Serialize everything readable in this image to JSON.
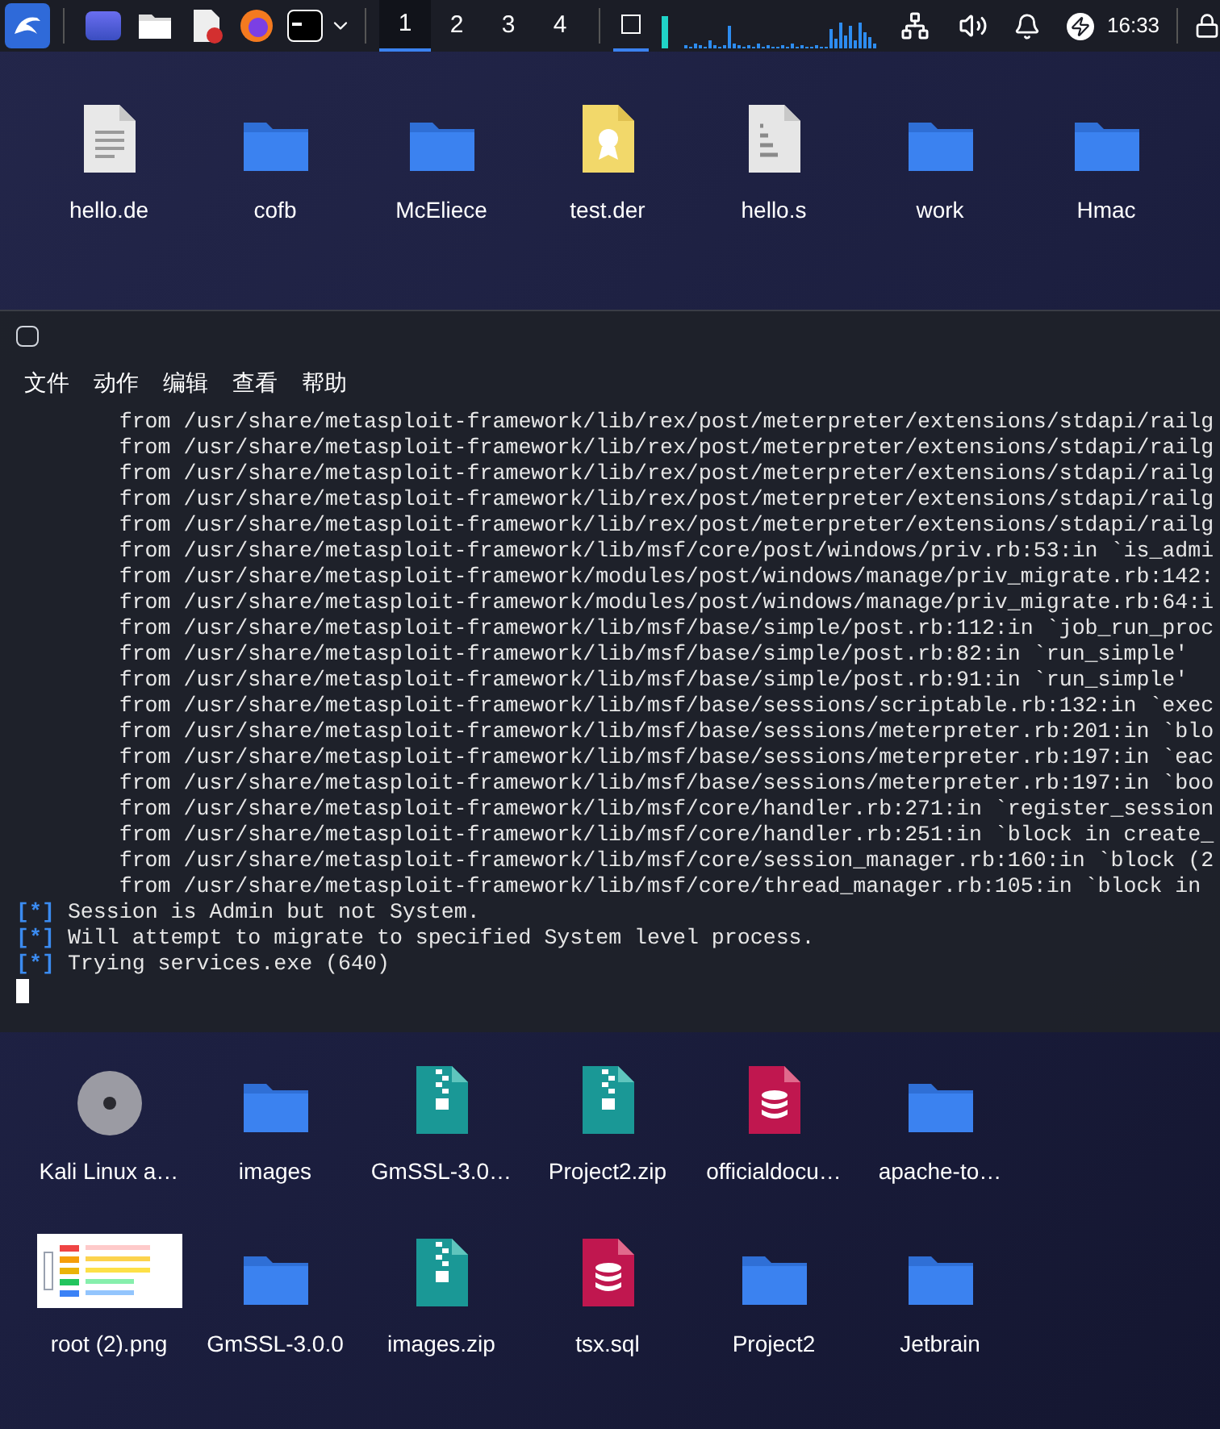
{
  "taskbar": {
    "workspaces": [
      {
        "label": "1",
        "selected": true
      },
      {
        "label": "2",
        "selected": false
      },
      {
        "label": "3",
        "selected": false
      },
      {
        "label": "4",
        "selected": false
      }
    ],
    "clock": "16:33"
  },
  "desktop_top": [
    {
      "label": "hello.de",
      "kind": "document"
    },
    {
      "label": "cofb",
      "kind": "folder"
    },
    {
      "label": "McEliece",
      "kind": "folder"
    },
    {
      "label": "test.der",
      "kind": "certificate"
    },
    {
      "label": "hello.s",
      "kind": "binary"
    },
    {
      "label": "work",
      "kind": "folder"
    },
    {
      "label": "Hmac",
      "kind": "folder"
    }
  ],
  "terminal": {
    "menu": [
      "文件",
      "动作",
      "编辑",
      "查看",
      "帮助"
    ],
    "lines": [
      {
        "kind": "trace",
        "text": "        from /usr/share/metasploit-framework/lib/rex/post/meterpreter/extensions/stdapi/railg"
      },
      {
        "kind": "trace",
        "text": "        from /usr/share/metasploit-framework/lib/rex/post/meterpreter/extensions/stdapi/railg"
      },
      {
        "kind": "trace",
        "text": "        from /usr/share/metasploit-framework/lib/rex/post/meterpreter/extensions/stdapi/railg"
      },
      {
        "kind": "trace",
        "text": "        from /usr/share/metasploit-framework/lib/rex/post/meterpreter/extensions/stdapi/railg"
      },
      {
        "kind": "trace",
        "text": "        from /usr/share/metasploit-framework/lib/rex/post/meterpreter/extensions/stdapi/railg"
      },
      {
        "kind": "trace",
        "text": "        from /usr/share/metasploit-framework/lib/msf/core/post/windows/priv.rb:53:in `is_admi"
      },
      {
        "kind": "trace",
        "text": "        from /usr/share/metasploit-framework/modules/post/windows/manage/priv_migrate.rb:142:"
      },
      {
        "kind": "trace",
        "text": "        from /usr/share/metasploit-framework/modules/post/windows/manage/priv_migrate.rb:64:i"
      },
      {
        "kind": "trace",
        "text": "        from /usr/share/metasploit-framework/lib/msf/base/simple/post.rb:112:in `job_run_proc"
      },
      {
        "kind": "trace",
        "text": "        from /usr/share/metasploit-framework/lib/msf/base/simple/post.rb:82:in `run_simple'"
      },
      {
        "kind": "trace",
        "text": "        from /usr/share/metasploit-framework/lib/msf/base/simple/post.rb:91:in `run_simple'"
      },
      {
        "kind": "trace",
        "text": "        from /usr/share/metasploit-framework/lib/msf/base/sessions/scriptable.rb:132:in `exec"
      },
      {
        "kind": "trace",
        "text": "        from /usr/share/metasploit-framework/lib/msf/base/sessions/meterpreter.rb:201:in `blo"
      },
      {
        "kind": "trace",
        "text": "        from /usr/share/metasploit-framework/lib/msf/base/sessions/meterpreter.rb:197:in `eac"
      },
      {
        "kind": "trace",
        "text": "        from /usr/share/metasploit-framework/lib/msf/base/sessions/meterpreter.rb:197:in `boo"
      },
      {
        "kind": "trace",
        "text": "        from /usr/share/metasploit-framework/lib/msf/core/handler.rb:271:in `register_session"
      },
      {
        "kind": "trace",
        "text": "        from /usr/share/metasploit-framework/lib/msf/core/handler.rb:251:in `block in create_"
      },
      {
        "kind": "trace",
        "text": "        from /usr/share/metasploit-framework/lib/msf/core/session_manager.rb:160:in `block (2"
      },
      {
        "kind": "trace",
        "text": "        from /usr/share/metasploit-framework/lib/msf/core/thread_manager.rb:105:in `block in "
      },
      {
        "kind": "status",
        "prefix": "[*]",
        "text": "Session is Admin but not System."
      },
      {
        "kind": "status",
        "prefix": "[*]",
        "text": "Will attempt to migrate to specified System level process."
      },
      {
        "kind": "status",
        "prefix": "[*]",
        "text": "Trying services.exe (640)"
      }
    ]
  },
  "desktop_bottom": [
    {
      "label": "Kali Linux a…",
      "kind": "disc"
    },
    {
      "label": "images",
      "kind": "folder"
    },
    {
      "label": "GmSSL-3.0…",
      "kind": "archive"
    },
    {
      "label": "Project2.zip",
      "kind": "archive"
    },
    {
      "label": "officialdocu…",
      "kind": "database"
    },
    {
      "label": "apache-to…",
      "kind": "folder"
    },
    {
      "label": "root (2).png",
      "kind": "image"
    },
    {
      "label": "GmSSL-3.0.0",
      "kind": "folder"
    },
    {
      "label": "images.zip",
      "kind": "archive"
    },
    {
      "label": "tsx.sql",
      "kind": "database"
    },
    {
      "label": "Project2",
      "kind": "folder"
    },
    {
      "label": "Jetbrain",
      "kind": "folder"
    }
  ]
}
